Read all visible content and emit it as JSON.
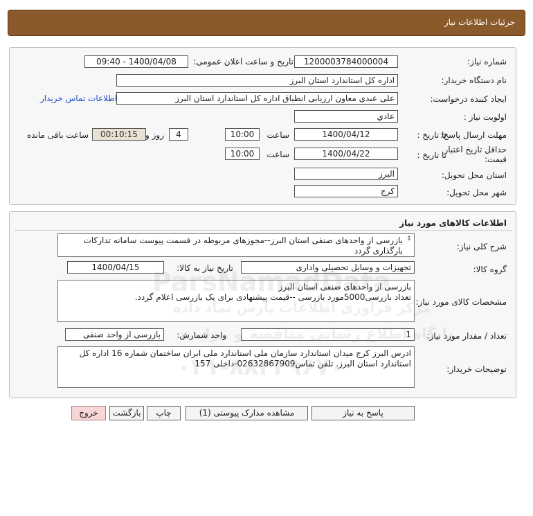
{
  "header": {
    "title": "جزئیات اطلاعات نیاز"
  },
  "info": {
    "need_number_label": "شماره نیاز:",
    "need_number": "1200003784000004",
    "announce_label": "تاریخ و ساعت اعلان عمومی:",
    "announce_value": "1400/04/08 - 09:40",
    "buyer_org_label": "نام دستگاه خریدار:",
    "buyer_org": "اداره کل استاندارد استان البرز",
    "requester_label": "ایجاد کننده درخواست:",
    "requester": "علی عبدی معاون ارزیابی انطباق اداره کل استاندارد استان البرز",
    "contact_link": "اطلاعات تماس خریدار",
    "priority_label": "اولویت نیاز :",
    "priority": "عادي",
    "deadline_label": "مهلت ارسال پاسخ:",
    "to_date_label": "تا تاریخ :",
    "deadline_date": "1400/04/12",
    "time_label": "ساعت",
    "deadline_time": "10:00",
    "days_value": "4",
    "days_label": "روز و",
    "remaining_time": "00:10:15",
    "remaining_label": "ساعت باقی مانده",
    "validity_label_1": "حداقل تاریخ اعتبار",
    "validity_label_2": "قیمت:",
    "validity_date": "1400/04/22",
    "validity_time": "10:00",
    "province_label": "استان محل تحویل:",
    "province": "البرز",
    "city_label": "شهر محل تحویل:",
    "city": "کرج"
  },
  "goods": {
    "title": "اطلاعات کالاهای مورد نیاز",
    "general_desc_label": "شرح کلی نیاز:",
    "general_desc": "بازرسی از واحدهای صنفی استان البرز--مجوزهای مربوطه در قسمت پیوست سامانه تدارکات بارگذاری گردد",
    "group_label": "گروه کالا:",
    "group": "تجهیزات و وسایل تحصیلی واداری",
    "need_date_label": "تاریخ نیاز به کالا:",
    "need_date": "1400/04/15",
    "specs_label": "مشخصات کالای مورد نیاز:",
    "specs_line1": "بازرسی از واحدهای صنفی استان البرز",
    "specs_line2": "تعداد بازرسی5000مورد بازرسی --قیمت پیشنهادی برای یک بازرسی اعلام گردد.",
    "qty_label": "تعداد / مقدار مورد نیاز:",
    "qty": "1",
    "unit_label": "واحد شمارش:",
    "unit": "بازرسی از واحد صنفی",
    "buyer_notes_label": "توضیحات خریدار:",
    "buyer_notes": "ادرس البرز کرج میدان استاندارد سازمان ملی استاندارد ملی ایران ساختمان شماره 16 اداره کل استاندارد استان البرز. تلفن تماس02632867909-داخلی 157"
  },
  "buttons": {
    "reply": "پاسخ به نیاز",
    "attachments": "مشاهده مدارک پیوستی (1)",
    "print": "چاپ",
    "back": "بازگشت",
    "exit": "خروج"
  },
  "watermark": {
    "brand": "ParsNamadData",
    "line1": "مرکز فراوری اطلاعات پارس نماد داده",
    "line2": "پایگاه اطلاع رسانی مناقصه و مزایده",
    "phone": "۰۲۱-۸۸۳۴۹۶۷۰"
  },
  "colors": {
    "header_bg": "#8b5a2b",
    "link": "#1a4fc4",
    "exit_button": "#f8d6d6",
    "timer_bg": "#e8e0d0"
  }
}
